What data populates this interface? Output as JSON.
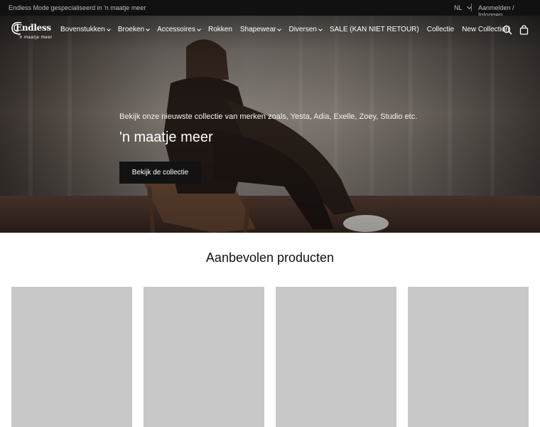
{
  "topbar": {
    "tagline": "Endless Mode gespecialiseerd in 'n maatje meer",
    "language": "NL",
    "login": "Aanmelden / Inloggen"
  },
  "logo": {
    "brand": "Endless",
    "sub": "'n maatje meer"
  },
  "nav": {
    "items": [
      {
        "label": "Bovenstukken",
        "dropdown": true
      },
      {
        "label": "Broeken",
        "dropdown": true
      },
      {
        "label": "Accessoires",
        "dropdown": true
      },
      {
        "label": "Rokken",
        "dropdown": false
      },
      {
        "label": "Shapewear",
        "dropdown": true
      },
      {
        "label": "Diversen",
        "dropdown": true
      },
      {
        "label": "SALE (KAN NIET RETOUR)",
        "dropdown": false
      },
      {
        "label": "Collectie",
        "dropdown": false
      },
      {
        "label": "New Collection",
        "dropdown": false
      }
    ],
    "icons": [
      "search-icon",
      "shopping-bag-icon"
    ]
  },
  "hero": {
    "subtitle": "Bekijk onze nieuwste collectie van merken zoals, Yesta, Adia, Exelle, Zoey, Studio etc.",
    "title": "'n maatje meer",
    "button": "Bekijk de collectie"
  },
  "products": {
    "title": "Aanbevolen producten",
    "count_visible": 4
  },
  "colors": {
    "topbar": "#111111",
    "button": "#121212",
    "placeholder": "#c8c8c8"
  }
}
